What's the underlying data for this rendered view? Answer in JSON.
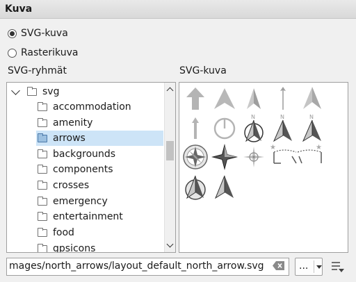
{
  "header": {
    "title": "Kuva"
  },
  "source": {
    "options": [
      {
        "label": "SVG-kuva",
        "checked": true
      },
      {
        "label": "Rasterikuva",
        "checked": false
      }
    ]
  },
  "groups": {
    "label": "SVG-ryhmät",
    "root": "svg",
    "items": [
      "accommodation",
      "amenity",
      "arrows",
      "backgrounds",
      "components",
      "crosses",
      "emergency",
      "entertainment",
      "food",
      "gpsicons"
    ],
    "selected": "arrows"
  },
  "images": {
    "label": "SVG-kuva",
    "icons": [
      "arrow-up-thick-icon",
      "triangle-arrow-icon",
      "sharp-arrow-icon",
      "thin-north-arrow-icon",
      "tall-arrow-icon",
      "simple-up-arrow-icon",
      "circle-north-icon",
      "circle-n-arrow-icon",
      "n-arrow-icon",
      "n-arrow-alt-icon",
      "compass-rose-icon",
      "four-point-star-icon",
      "crosshair-star-icon",
      "bracket-arrow-icon",
      "bracket-arrow-alt-icon",
      "circle-arrow-icon",
      "half-arrow-icon"
    ]
  },
  "path": {
    "value": "mages/north_arrows/layout_default_north_arrow.svg"
  },
  "browse": {
    "label": "..."
  },
  "colors": {
    "selection": "#cde4f7",
    "icon_gray": "#b4b4b4",
    "icon_dark": "#444444"
  }
}
